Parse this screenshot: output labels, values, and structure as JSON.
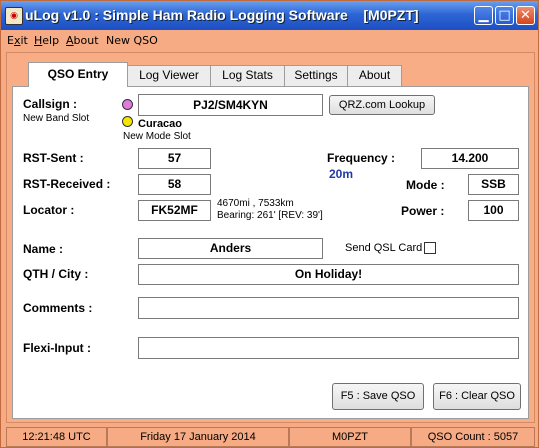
{
  "window": {
    "title": "uLog v1.0 : Simple Ham Radio Logging Software    [M0PZT]",
    "minimize": "▁",
    "maximize": "□",
    "close": "✕"
  },
  "menu": {
    "items": [
      {
        "label": "Exit",
        "accel": "x"
      },
      {
        "label": "Help",
        "accel": "H"
      },
      {
        "label": "About",
        "accel": "A"
      },
      {
        "label": "New QSO",
        "accel": ""
      }
    ]
  },
  "tabs": [
    "QSO Entry",
    "Log Viewer",
    "Log Stats",
    "Settings",
    "About"
  ],
  "form": {
    "callsign_label": "Callsign :",
    "callsign_value": "PJ2/SM4KYN",
    "new_band_slot": "New Band Slot",
    "country": "Curacao",
    "new_mode_slot": "New Mode Slot",
    "qrz_button": "QRZ.com Lookup",
    "rst_sent_label": "RST-Sent :",
    "rst_sent_value": "57",
    "rst_received_label": "RST-Received :",
    "rst_received_value": "58",
    "locator_label": "Locator :",
    "locator_value": "FK52MF",
    "distance": "4670mi , 7533km",
    "bearing": "Bearing: 261' [REV: 39']",
    "frequency_label": "Frequency :",
    "frequency_value": "14.200",
    "band": "20m",
    "mode_label": "Mode :",
    "mode_value": "SSB",
    "power_label": "Power :",
    "power_value": "100",
    "name_label": "Name :",
    "name_value": "Anders",
    "send_qsl_label": "Send QSL Card",
    "qth_label": "QTH / City :",
    "qth_value": "On Holiday!",
    "comments_label": "Comments :",
    "comments_value": "",
    "flexi_label": "Flexi-Input :",
    "flexi_value": "",
    "save_button": "F5 : Save QSO",
    "clear_button": "F6 : Clear QSO"
  },
  "status": {
    "time": "12:21:48  UTC",
    "date": "Friday 17 January 2014",
    "callsign": "M0PZT",
    "count": "QSO Count : 5057"
  },
  "colors": {
    "band_slot_dot": "#e07ae0",
    "mode_slot_dot": "#f5e600",
    "band_text": "#1f3aa6",
    "background": "#f6ab84"
  }
}
